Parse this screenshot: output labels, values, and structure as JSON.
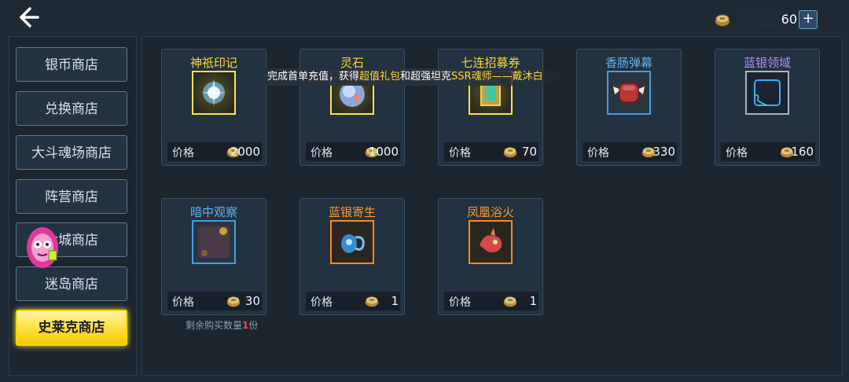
{
  "header": {
    "currency_amount": "60",
    "plus_label": "+"
  },
  "sidebar": {
    "items": [
      {
        "label": "银币商店"
      },
      {
        "label": "兑换商店"
      },
      {
        "label": "大斗魂场商店"
      },
      {
        "label": "阵营商店"
      },
      {
        "label": "七城商店"
      },
      {
        "label": "迷岛商店"
      },
      {
        "label": "史莱克商店",
        "active": true
      }
    ]
  },
  "shop": {
    "items": [
      {
        "name": "神祇印记",
        "quality": "gold",
        "price_label": "价格",
        "price": "2000"
      },
      {
        "name": "灵石",
        "quality": "gold",
        "price_label": "价格",
        "price": "1000"
      },
      {
        "name": "七连招募券",
        "quality": "gold",
        "price_label": "价格",
        "price": "70"
      },
      {
        "name": "香肠弹幕",
        "quality": "blue",
        "price_label": "价格",
        "price": "330"
      },
      {
        "name": "蓝银领域",
        "quality": "purple",
        "price_label": "价格",
        "price": "160"
      },
      {
        "name": "暗中观察",
        "quality": "blue",
        "price_label": "价格",
        "price": "30"
      },
      {
        "name": "蓝银寄生",
        "quality": "orange",
        "price_label": "价格",
        "price": "1"
      },
      {
        "name": "凤凰浴火",
        "quality": "orange",
        "price_label": "价格",
        "price": "1"
      }
    ],
    "remaining_prefix": "剩余购买数量",
    "remaining_count": "1",
    "remaining_suffix": "份"
  },
  "banner": {
    "part1": "完成首单充值，获得",
    "highlight1": "超值礼包",
    "part2": "和超强坦克",
    "highlight2": "SSR魂师——戴沐白"
  },
  "colors": {
    "gold": "#ffd433",
    "orange": "#ff9a2e",
    "blue": "#5fb4f0",
    "purple": "#b48cf0",
    "active_tab": "#ffe24a"
  },
  "icons": {
    "back": "back-arrow-icon",
    "coin": "gold-coin-icon",
    "plus": "plus-icon"
  }
}
